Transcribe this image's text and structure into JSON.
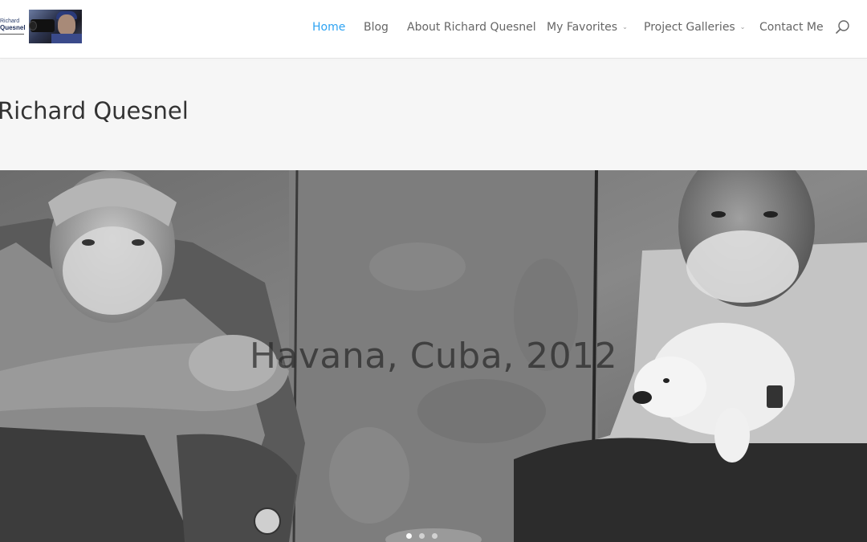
{
  "header": {
    "logo": {
      "line1": "Richard",
      "line2": "Quesnel",
      "icon": "photographer-with-camera"
    },
    "nav": [
      {
        "label": "Home",
        "active": true,
        "has_dropdown": false
      },
      {
        "label": "Blog",
        "active": false,
        "has_dropdown": false
      },
      {
        "label": "About Richard Quesnel",
        "active": false,
        "has_dropdown": false
      },
      {
        "label": "My Favorites",
        "active": false,
        "has_dropdown": true
      },
      {
        "label": "Project Galleries",
        "active": false,
        "has_dropdown": true
      },
      {
        "label": "Contact Me",
        "active": false,
        "has_dropdown": false
      }
    ],
    "search_icon": "search-icon"
  },
  "page": {
    "title": "Richard Quesnel"
  },
  "slider": {
    "caption": "Havana, Cuba, 2012",
    "image": "black-and-white photo of two elderly bearded men sitting against a wall, one holding a white puppy",
    "dots_count": 3,
    "active_dot": 1
  },
  "colors": {
    "accent": "#2ea3f2",
    "nav_text": "#666666",
    "title_band": "#f6f6f6",
    "title_text": "#333333"
  }
}
